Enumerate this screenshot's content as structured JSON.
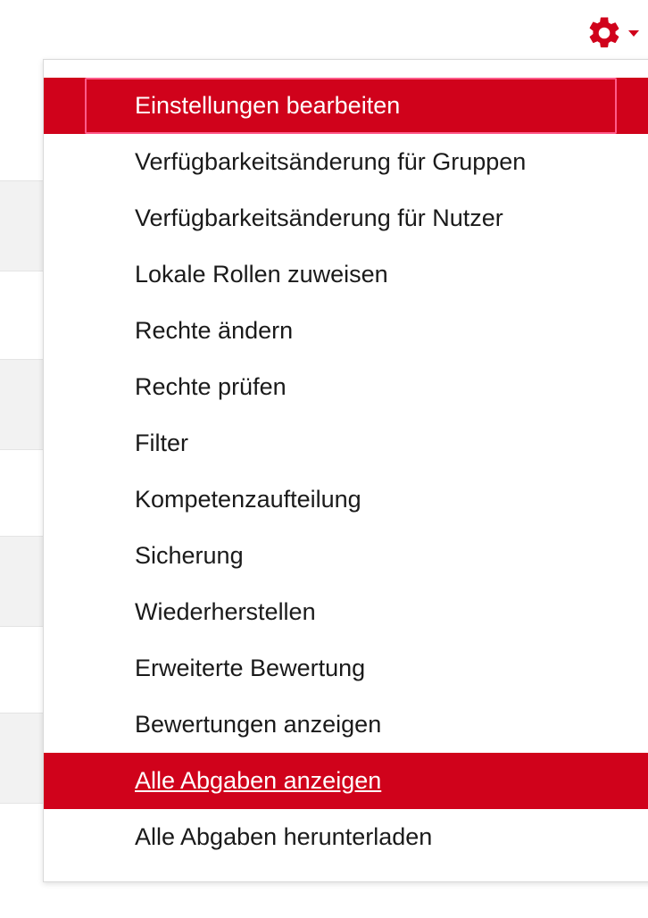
{
  "colors": {
    "accent": "#d0021b",
    "menu_text": "#1a1a1a",
    "active_text": "#ffffff"
  },
  "trigger": {
    "icon": "gear-icon",
    "caret_icon": "chevron-down-icon"
  },
  "menu": {
    "items": [
      {
        "label": "Einstellungen bearbeiten",
        "state": "active-focused"
      },
      {
        "label": "Verfügbarkeitsänderung für Gruppen",
        "state": "normal"
      },
      {
        "label": "Verfügbarkeitsänderung für Nutzer",
        "state": "normal"
      },
      {
        "label": "Lokale Rollen zuweisen",
        "state": "normal"
      },
      {
        "label": "Rechte ändern",
        "state": "normal"
      },
      {
        "label": "Rechte prüfen",
        "state": "normal"
      },
      {
        "label": "Filter",
        "state": "normal"
      },
      {
        "label": "Kompetenzaufteilung",
        "state": "normal"
      },
      {
        "label": "Sicherung",
        "state": "normal"
      },
      {
        "label": "Wiederherstellen",
        "state": "normal"
      },
      {
        "label": "Erweiterte Bewertung",
        "state": "normal"
      },
      {
        "label": "Bewertungen anzeigen",
        "state": "normal"
      },
      {
        "label": "Alle Abgaben anzeigen",
        "state": "hovered"
      },
      {
        "label": "Alle Abgaben herunterladen",
        "state": "normal"
      }
    ]
  }
}
